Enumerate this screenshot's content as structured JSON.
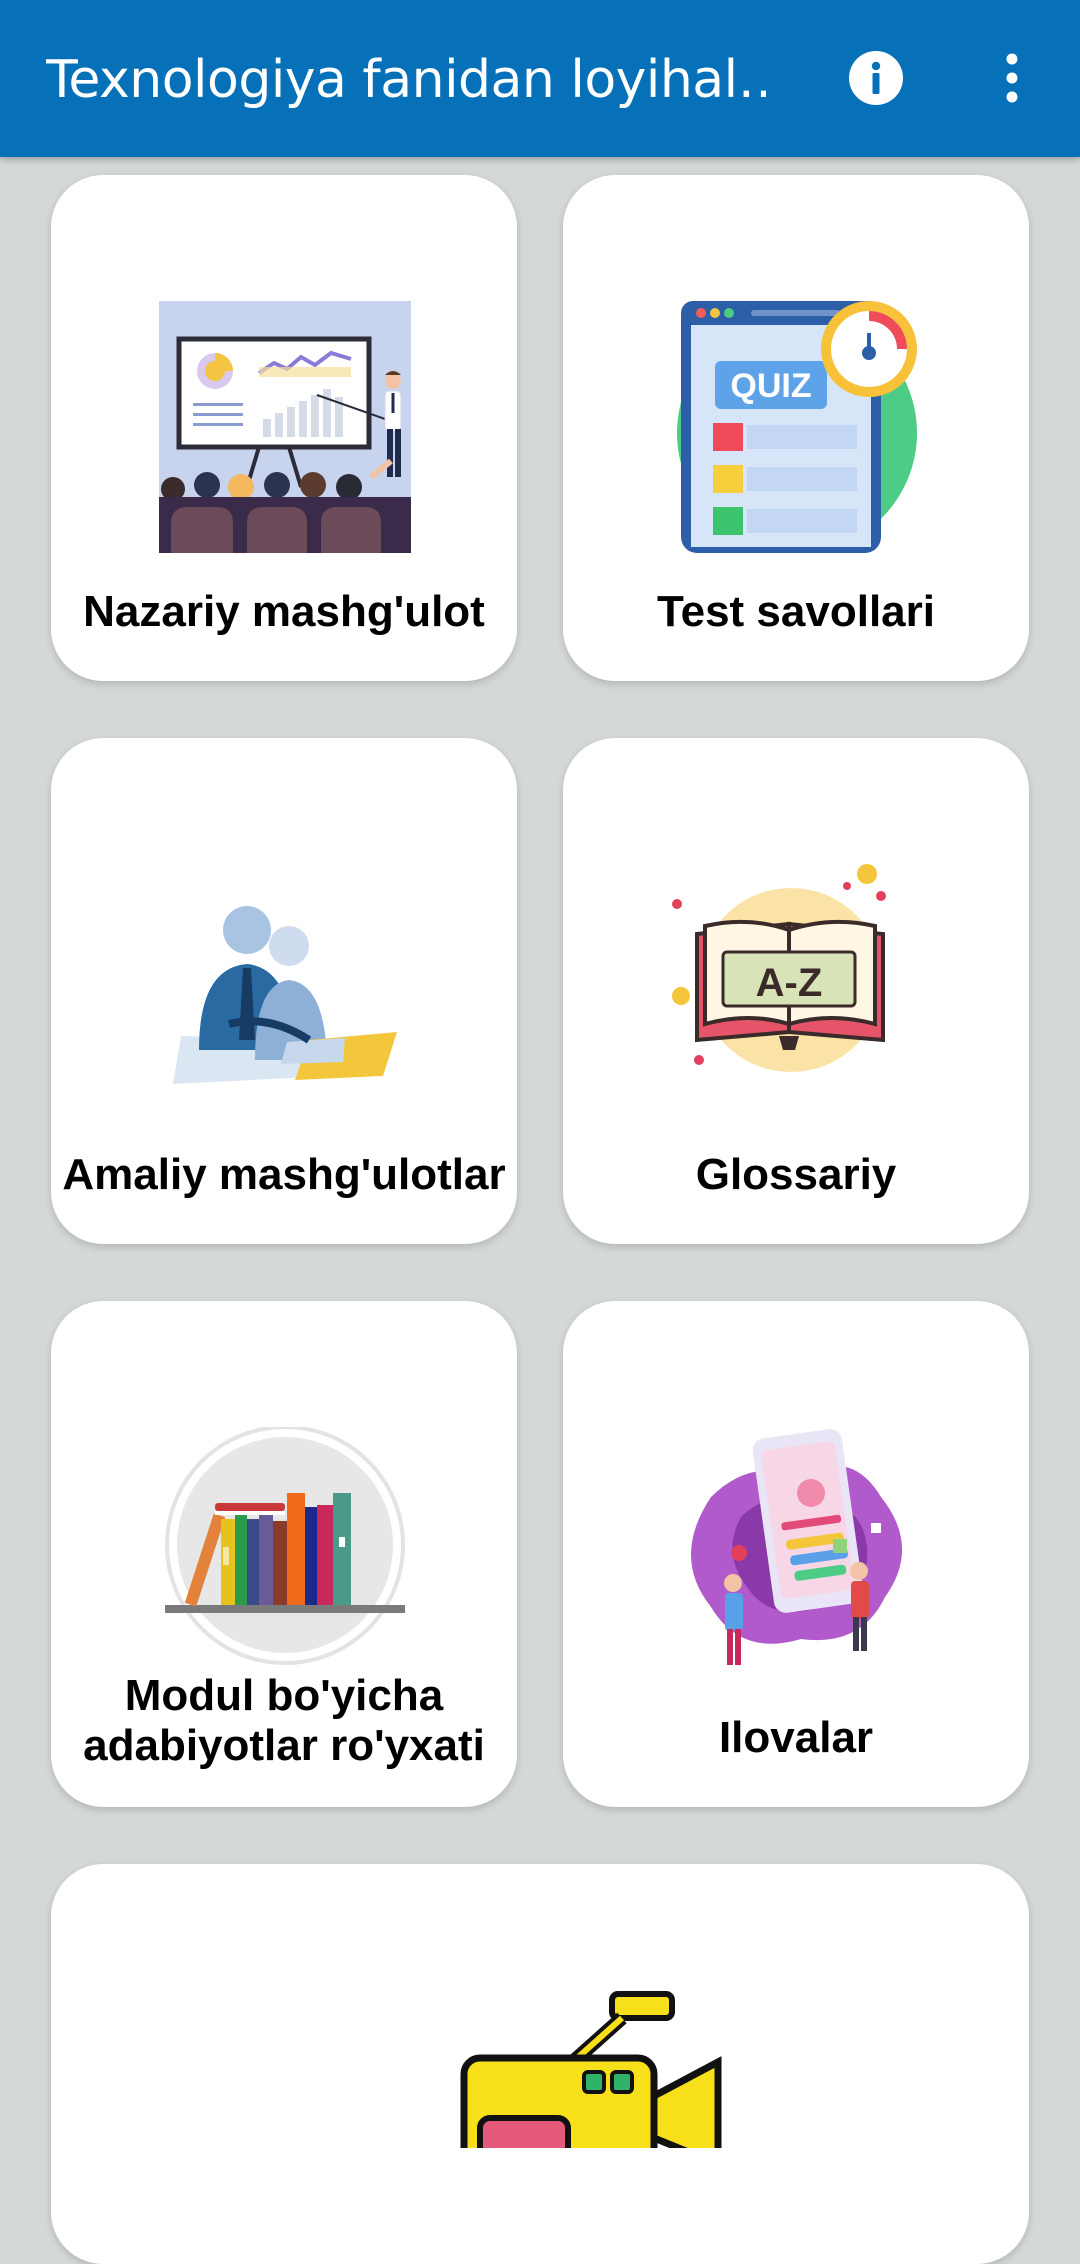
{
  "appbar": {
    "title": "Texnologiya fanidan loyihal…",
    "info_icon": "info-icon",
    "menu_icon": "more-vert-icon",
    "background": "#0671b8"
  },
  "menu": {
    "items": [
      {
        "label": "Nazariy mashg'ulot",
        "icon": "presentation-illustration"
      },
      {
        "label": "Test savollari",
        "icon": "quiz-illustration"
      },
      {
        "label": "Amaliy mashg'ulotlar",
        "icon": "workers-illustration"
      },
      {
        "label": "Glossariy",
        "icon": "dictionary-illustration"
      },
      {
        "label_line1": "Modul bo'yicha",
        "label_line2": "adabiyotlar ro'yxati",
        "icon": "books-illustration"
      },
      {
        "label": "Ilovalar",
        "icon": "mobile-apps-illustration"
      },
      {
        "icon": "video-camera-illustration"
      }
    ]
  },
  "colors": {
    "page_background": "#d5d8d8",
    "card_background": "#ffffff"
  }
}
